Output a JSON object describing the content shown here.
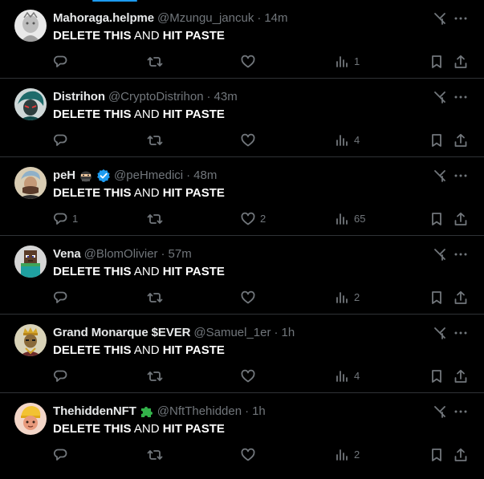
{
  "colors": {
    "background": "#000000",
    "text": "#e7e9ea",
    "muted": "#71767b",
    "divider": "#2f3336",
    "verified": "#1d9bf0",
    "puzzle": "#33b24a"
  },
  "icons": {
    "reply": "reply-icon",
    "retweet": "retweet-icon",
    "like": "heart-icon",
    "views": "views-chart-icon",
    "bookmark": "bookmark-icon",
    "share": "share-icon",
    "grok": "grok-icon",
    "more": "more-dots-icon"
  },
  "tweets": [
    {
      "name": "Mahoraga.helpme",
      "handle": "@Mzungu_jancuk",
      "time": "14m",
      "text_bold_1": "DELETE THIS",
      "text_normal": " AND ",
      "text_bold_2": "HIT PASTE",
      "replies": "",
      "retweets": "",
      "likes": "",
      "views": "1",
      "avatar_color": "#d8d8d8"
    },
    {
      "name": "Distrihon",
      "handle": "@CryptoDistrihon",
      "time": "43m",
      "text_bold_1": "DELETE THIS",
      "text_normal": " AND ",
      "text_bold_2": "HIT PASTE",
      "replies": "",
      "retweets": "",
      "likes": "",
      "views": "4",
      "avatar_color": "#2a6a6a"
    },
    {
      "name": "peH",
      "handle": "@peHmedici",
      "time": "48m",
      "text_bold_1": "DELETE THIS",
      "text_normal": " AND ",
      "text_bold_2": "HIT PASTE",
      "replies": "1",
      "retweets": "",
      "likes": "2",
      "views": "65",
      "avatar_color": "#c9b79a"
    },
    {
      "name": "Vena",
      "handle": "@BlomOlivier",
      "time": "57m",
      "text_bold_1": "DELETE THIS",
      "text_normal": " AND ",
      "text_bold_2": "HIT PASTE",
      "replies": "",
      "retweets": "",
      "likes": "",
      "views": "2",
      "avatar_color": "#3fa35a"
    },
    {
      "name": "Grand Monarque $EVER",
      "handle": "@Samuel_1er",
      "time": "1h",
      "text_bold_1": "DELETE THIS",
      "text_normal": " AND ",
      "text_bold_2": "HIT PASTE",
      "replies": "",
      "retweets": "",
      "likes": "",
      "views": "4",
      "avatar_color": "#9a7a3a"
    },
    {
      "name": "ThehiddenNFT",
      "handle": "@NftThehidden",
      "time": "1h",
      "text_bold_1": "DELETE THIS",
      "text_normal": " AND ",
      "text_bold_2": "HIT PASTE",
      "replies": "",
      "retweets": "",
      "likes": "",
      "views": "2",
      "avatar_color": "#f0a088"
    }
  ],
  "separator": "·"
}
